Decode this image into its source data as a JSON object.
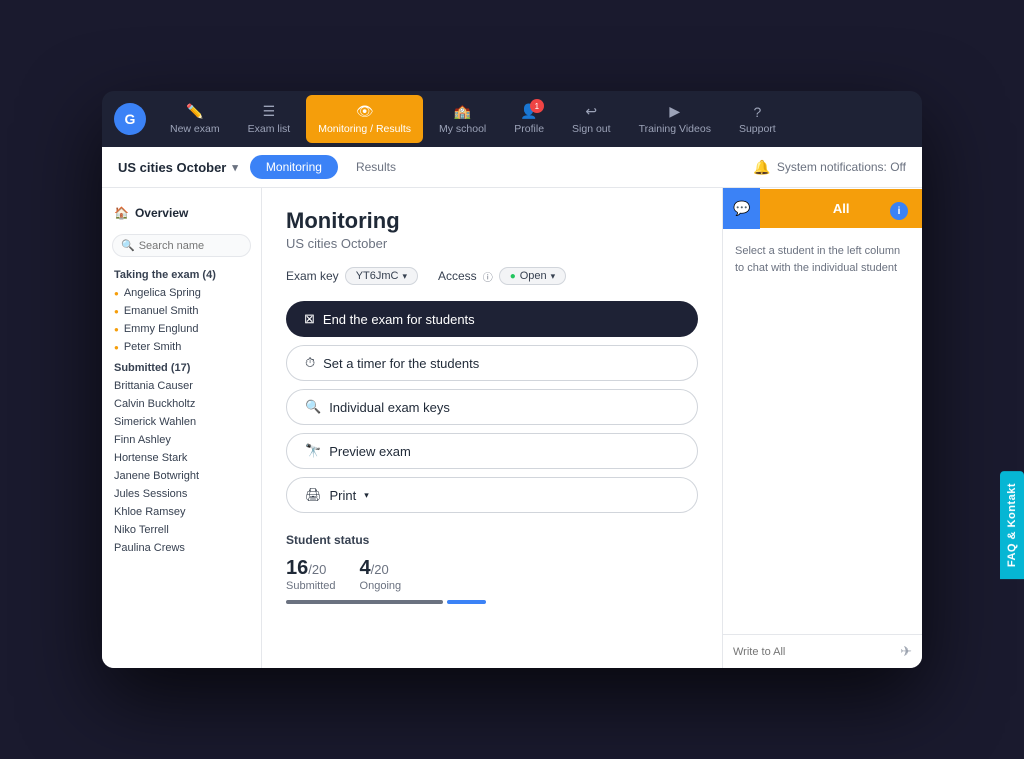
{
  "app": {
    "logo_text": "G"
  },
  "nav": {
    "items": [
      {
        "id": "new-exam",
        "label": "New exam",
        "icon": "✏️"
      },
      {
        "id": "exam-list",
        "label": "Exam list",
        "icon": "☰"
      },
      {
        "id": "monitoring",
        "label": "Monitoring / Results",
        "icon": "👁",
        "active": true
      },
      {
        "id": "my-school",
        "label": "My school",
        "icon": "🏫"
      },
      {
        "id": "profile",
        "label": "Profile",
        "icon": "👤",
        "badge": "1"
      },
      {
        "id": "sign-out",
        "label": "Sign out",
        "icon": "↩"
      },
      {
        "id": "training",
        "label": "Training Videos",
        "icon": "▶"
      },
      {
        "id": "support",
        "label": "Support",
        "icon": "?"
      }
    ]
  },
  "sub_header": {
    "exam_name": "US cities October",
    "tabs": [
      {
        "id": "monitoring",
        "label": "Monitoring",
        "active": true
      },
      {
        "id": "results",
        "label": "Results",
        "active": false
      }
    ],
    "notification": "System notifications: Off"
  },
  "sidebar": {
    "overview_label": "Overview",
    "search_placeholder": "Search name",
    "taking_section_title": "Taking the exam (4)",
    "taking_students": [
      {
        "name": "Angelica Spring"
      },
      {
        "name": "Emanuel Smith"
      },
      {
        "name": "Emmy Englund"
      },
      {
        "name": "Peter Smith"
      }
    ],
    "submitted_section_title": "Submitted (17)",
    "submitted_students": [
      {
        "name": "Brittania Causer"
      },
      {
        "name": "Calvin Buckholtz"
      },
      {
        "name": "Simerick Wahlen"
      },
      {
        "name": "Finn Ashley"
      },
      {
        "name": "Hortense Stark"
      },
      {
        "name": "Janene Botwright"
      },
      {
        "name": "Jules Sessions"
      },
      {
        "name": "Khloe Ramsey"
      },
      {
        "name": "Niko Terrell"
      },
      {
        "name": "Paulina Crews"
      }
    ]
  },
  "monitoring": {
    "title": "Monitoring",
    "subtitle": "US cities October",
    "exam_key_label": "Exam key",
    "exam_key_value": "YT6JmC",
    "access_label": "Access",
    "access_value": "Open",
    "buttons": {
      "end_exam": "End the exam for students",
      "set_timer": "Set a timer for the students",
      "individual_keys": "Individual exam keys",
      "preview_exam": "Preview exam",
      "print": "Print"
    },
    "student_status": {
      "title": "Student status",
      "submitted_num": "16",
      "submitted_denom": "/20",
      "submitted_label": "Submitted",
      "ongoing_num": "4",
      "ongoing_denom": "/20",
      "ongoing_label": "Ongoing"
    }
  },
  "chat": {
    "tab_all_label": "All",
    "body_text": "Select a student in the left column to chat with the individual student",
    "write_placeholder": "Write to All",
    "send_icon": "✈"
  },
  "faq": {
    "label": "FAQ & Kontakt"
  }
}
